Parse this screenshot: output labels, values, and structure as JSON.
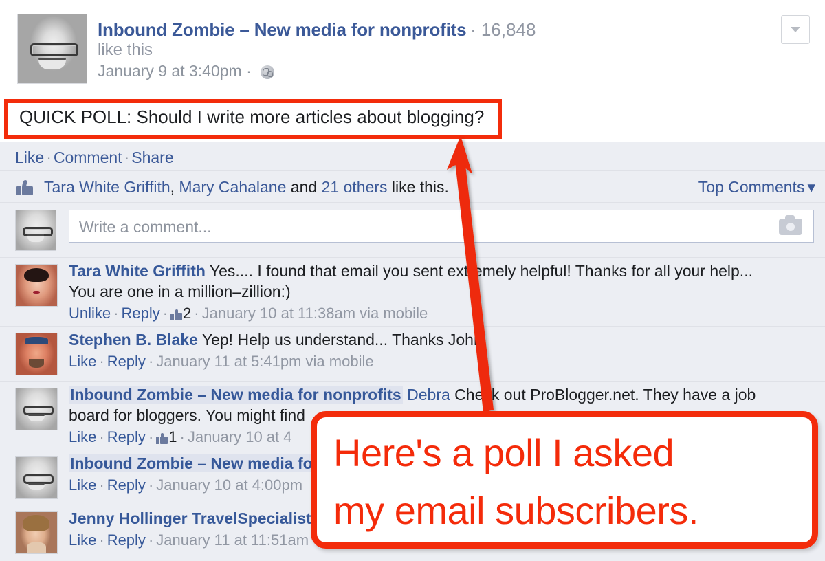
{
  "post": {
    "page_name": "Inbound Zombie – New media for nonprofits",
    "separator": "·",
    "likes_count": "16,848",
    "like_this": "like this",
    "timestamp": "January 9 at 3:40pm",
    "privacy_icon": "globe-icon",
    "menu_icon": "chevron-down-icon",
    "message": "QUICK POLL: Should I write more articles about blogging?"
  },
  "actions": {
    "like": "Like",
    "comment": "Comment",
    "share": "Share",
    "separator": "·"
  },
  "likes_bar": {
    "thumb_icon": "thumbs-up-icon",
    "name1": "Tara White Griffith",
    "comma": ", ",
    "name2": "Mary Cahalane",
    "and": " and ",
    "others": "21 others",
    "suffix": " like this.",
    "sort_label": "Top Comments",
    "sort_caret": "▾"
  },
  "composer": {
    "placeholder": "Write a comment...",
    "camera_icon": "camera-icon"
  },
  "comments": [
    {
      "author": "Tara White Griffith",
      "author_is_page": false,
      "mention": "",
      "text_line1": " Yes.... I found that email you sent extremely helpful! Thanks for all your help...",
      "text_line2": "You are one in a million–zillion:)",
      "like_action": "Unlike",
      "reply_action": "Reply",
      "like_count": "2",
      "timestamp": "January 10 at 11:38am via mobile"
    },
    {
      "author": "Stephen B. Blake",
      "author_is_page": false,
      "mention": "",
      "text_line1": " Yep! Help us understand... Thanks John!",
      "text_line2": "",
      "like_action": "Like",
      "reply_action": "Reply",
      "like_count": "",
      "timestamp": "January 11 at 5:41pm via mobile"
    },
    {
      "author": "Inbound Zombie – New media for nonprofits",
      "author_is_page": true,
      "mention": "Debra",
      "text_line1": " Check out ProBlogger.net. They have a job",
      "text_line2": "board for bloggers. You might find",
      "like_action": "Like",
      "reply_action": "Reply",
      "like_count": "1",
      "timestamp": "January 10 at 4"
    },
    {
      "author": "Inbound Zombie – New media fo",
      "author_is_page": true,
      "mention": "",
      "text_line1": "",
      "text_line2": "",
      "like_action": "Like",
      "reply_action": "Reply",
      "like_count": "",
      "timestamp": "January 10 at 4:00pm"
    },
    {
      "author": "Jenny Hollinger TravelSpecialist",
      "author_is_page": false,
      "mention": "",
      "text_line1": "",
      "text_line2": "",
      "like_action": "Like",
      "reply_action": "Reply",
      "like_count": "",
      "timestamp": "January 11 at 11:51am"
    }
  ],
  "annotation": {
    "callout_line1": "Here's a poll I asked",
    "callout_line2": "my email subscribers.",
    "accent_color": "#f32c0b",
    "arrow_name": "annotation-arrow"
  }
}
